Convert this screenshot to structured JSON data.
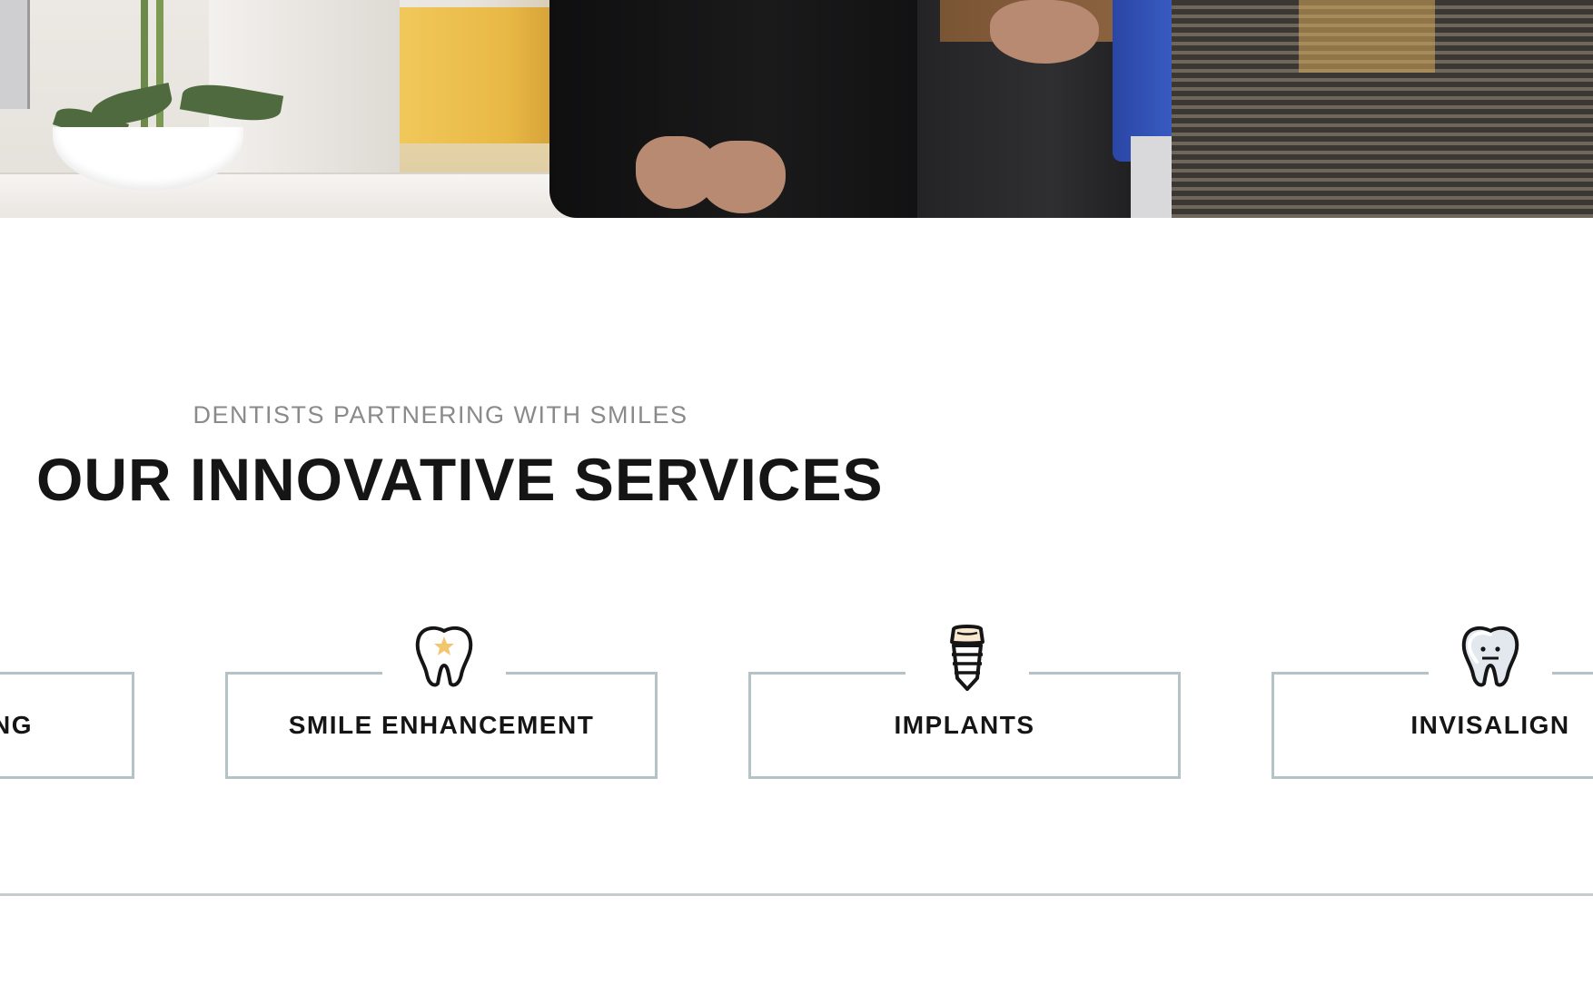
{
  "hero": {
    "alt": "Dentists standing together in the office"
  },
  "section": {
    "kicker": "DENTISTS PARTNERING WITH SMILES",
    "title": "OUR INNOVATIVE SERVICES"
  },
  "services": [
    {
      "label": "NG",
      "icon": "tooth-icon"
    },
    {
      "label": "SMILE ENHANCEMENT",
      "icon": "tooth-star-icon",
      "icon_accent": "#f2c66d"
    },
    {
      "label": "IMPLANTS",
      "icon": "implant-icon",
      "icon_accent": "#f7e8cf"
    },
    {
      "label": "INVISALIGN",
      "icon": "tooth-aligner-icon",
      "icon_accent": "#e3e8ef"
    }
  ],
  "colors": {
    "card_border": "#b5c3c9",
    "heading": "#151515",
    "kicker": "#8a8a8a",
    "divider": "#c6cbcd"
  }
}
